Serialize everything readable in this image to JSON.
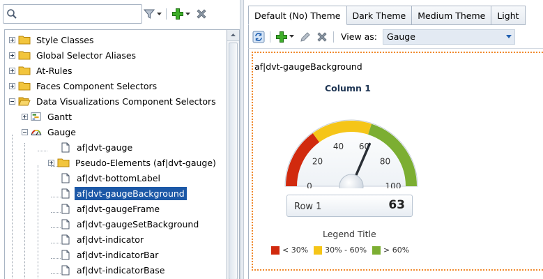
{
  "search": {
    "value": "",
    "placeholder": ""
  },
  "left_toolbar": {
    "icons": [
      "filter-icon",
      "add-icon",
      "delete-icon"
    ]
  },
  "tree": {
    "items": [
      {
        "label": "Style Classes",
        "icon": "folder-icon"
      },
      {
        "label": "Global Selector Aliases",
        "icon": "folder-icon"
      },
      {
        "label": "At-Rules",
        "icon": "folder-icon"
      },
      {
        "label": "Faces Component Selectors",
        "icon": "folder-icon"
      },
      {
        "label": "Data Visualizations Component Selectors",
        "icon": "folder-open-icon"
      },
      {
        "label": "Gantt",
        "icon": "gantt-icon"
      },
      {
        "label": "Gauge",
        "icon": "gauge-icon"
      },
      {
        "label": "af|dvt-gauge",
        "icon": "document-icon"
      },
      {
        "label": "Pseudo-Elements (af|dvt-gauge)",
        "icon": "folder-icon"
      },
      {
        "label": "af|dvt-bottomLabel",
        "icon": "document-icon"
      },
      {
        "label": "af|dvt-gaugeBackground",
        "icon": "document-icon",
        "selected": true
      },
      {
        "label": "af|dvt-gaugeFrame",
        "icon": "document-icon"
      },
      {
        "label": "af|dvt-gaugeSetBackground",
        "icon": "document-icon"
      },
      {
        "label": "af|dvt-indicator",
        "icon": "document-icon"
      },
      {
        "label": "af|dvt-indicatorBar",
        "icon": "document-icon"
      },
      {
        "label": "af|dvt-indicatorBase",
        "icon": "document-icon"
      }
    ]
  },
  "tabs": [
    {
      "label": "Default (No) Theme",
      "active": true
    },
    {
      "label": "Dark Theme"
    },
    {
      "label": "Medium Theme"
    },
    {
      "label": "Light"
    }
  ],
  "right_toolbar": {
    "view_label": "View as:",
    "view_value": "Gauge",
    "icons": [
      "refresh-icon",
      "add-icon",
      "edit-icon",
      "delete-icon"
    ]
  },
  "preview": {
    "element_name": "af|dvt-gaugeBackground",
    "gauge": {
      "title": "Column 1",
      "ticks": [
        "0",
        "20",
        "40",
        "60",
        "80",
        "100"
      ],
      "min": 0,
      "max": 100,
      "value": 63,
      "row_label": "Row 1",
      "value_label": "63",
      "legend_title": "Legend Title",
      "legend": [
        {
          "label": "< 30%",
          "color": "#d12a0e"
        },
        {
          "label": "30% - 60%",
          "color": "#f5c518"
        },
        {
          "label": "> 60%",
          "color": "#7cae32"
        }
      ]
    }
  },
  "colors": {
    "selection": "#1c58a7",
    "accent": "#f0892c",
    "low": "#d12a0e",
    "mid": "#f5c518",
    "high": "#7cae32"
  }
}
